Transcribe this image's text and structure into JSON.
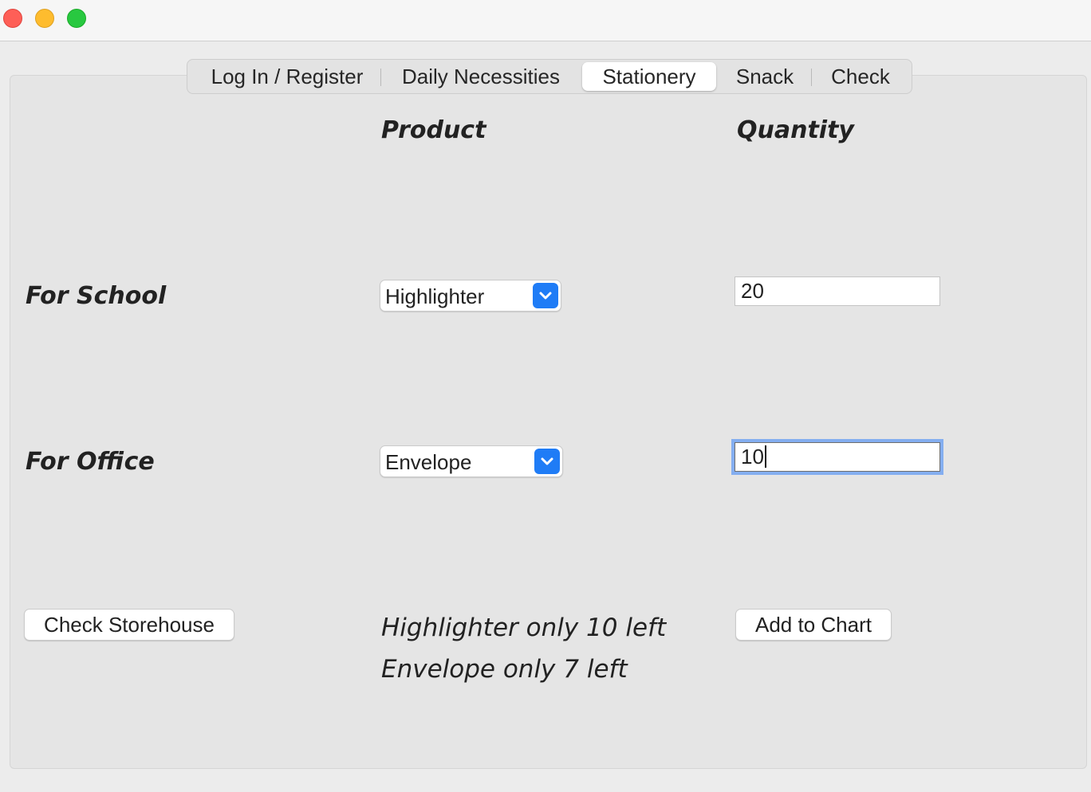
{
  "window": {
    "controls": [
      "close",
      "minimize",
      "zoom"
    ]
  },
  "tabs": [
    {
      "label": "Log In / Register",
      "active": false
    },
    {
      "label": "Daily Necessities",
      "active": false
    },
    {
      "label": "Stationery",
      "active": true
    },
    {
      "label": "Snack",
      "active": false
    },
    {
      "label": "Check",
      "active": false
    }
  ],
  "headers": {
    "product": "Product",
    "quantity": "Quantity"
  },
  "rows": [
    {
      "label": "For School",
      "product": "Highlighter",
      "quantity": "20"
    },
    {
      "label": "For Office",
      "product": "Envelope",
      "quantity": "10"
    }
  ],
  "buttons": {
    "check_storehouse": "Check Storehouse",
    "add_to_chart": "Add to Chart"
  },
  "status_messages": [
    "Highlighter only 10 left",
    "Envelope only 7 left"
  ],
  "icons": {
    "dropdown": "chevron-down-icon"
  },
  "colors": {
    "close": "#fe5f57",
    "minimize": "#febc2e",
    "zoom": "#28c840",
    "accent": "#1f7cf6",
    "focus_ring": "#84aef0"
  }
}
